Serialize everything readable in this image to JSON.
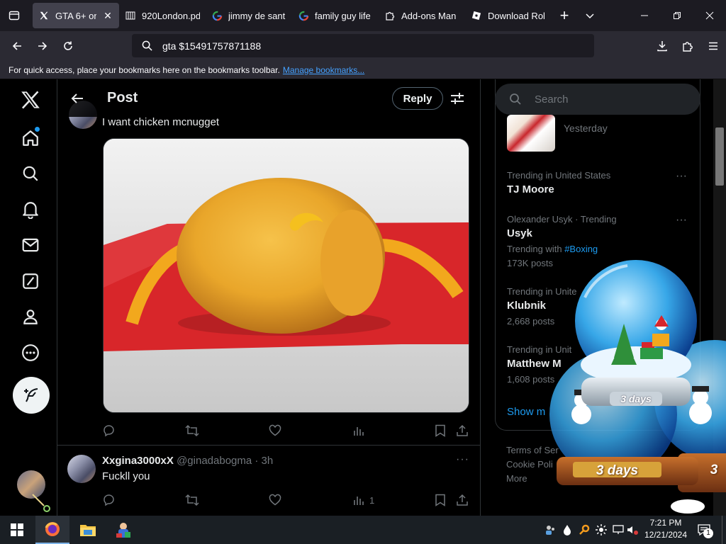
{
  "browser": {
    "tabs": [
      {
        "title": "GTA 6+ on",
        "icon": "x-logo-icon",
        "active": true
      },
      {
        "title": "920London.pd",
        "icon": "columns-doc-icon"
      },
      {
        "title": "jimmy de sant",
        "icon": "google-g-icon"
      },
      {
        "title": "family guy life",
        "icon": "google-g-icon"
      },
      {
        "title": "Add-ons Man",
        "icon": "puzzle-icon"
      },
      {
        "title": "Download Rol",
        "icon": "roblox-icon"
      }
    ],
    "url": "gta $15491757871188",
    "bookmarks_message": "For quick access, place your bookmarks here on the bookmarks toolbar.",
    "bookmarks_link": "Manage bookmarks..."
  },
  "x": {
    "header": {
      "title": "Post",
      "reply_label": "Reply"
    },
    "post": {
      "text": "I want chicken mcnugget"
    },
    "reply": {
      "name": "Xxgina3000xX",
      "handle": "@ginadabogma",
      "time": "· 3h",
      "text": "Fuckll you",
      "views": "1"
    },
    "search_placeholder": "Search",
    "trends": {
      "top_item_time": "Yesterday",
      "items": [
        {
          "context": "Trending in United States",
          "name": "TJ Moore"
        },
        {
          "context": "Olexander Usyk · Trending",
          "name": "Usyk",
          "extra_prefix": "Trending with",
          "extra_tag": "#Boxing",
          "posts": "173K posts"
        },
        {
          "context": "Trending in Unite",
          "name": "Klubnik",
          "posts": "2,668 posts"
        },
        {
          "context": "Trending in Unit",
          "name": "Matthew M",
          "posts": "1,608 posts"
        }
      ],
      "show_more": "Show m"
    },
    "footer": [
      "Terms of Ser",
      "Cookie Poli",
      "More"
    ]
  },
  "overlay": {
    "label1": "3 days",
    "label2": "3 days",
    "label3": "3"
  },
  "taskbar": {
    "time": "7:21 PM",
    "date": "12/21/2024",
    "notif_count": "1"
  },
  "colors": {
    "accent": "#1d9bf0",
    "background": "#000000",
    "chrome": "#2b2a33"
  }
}
